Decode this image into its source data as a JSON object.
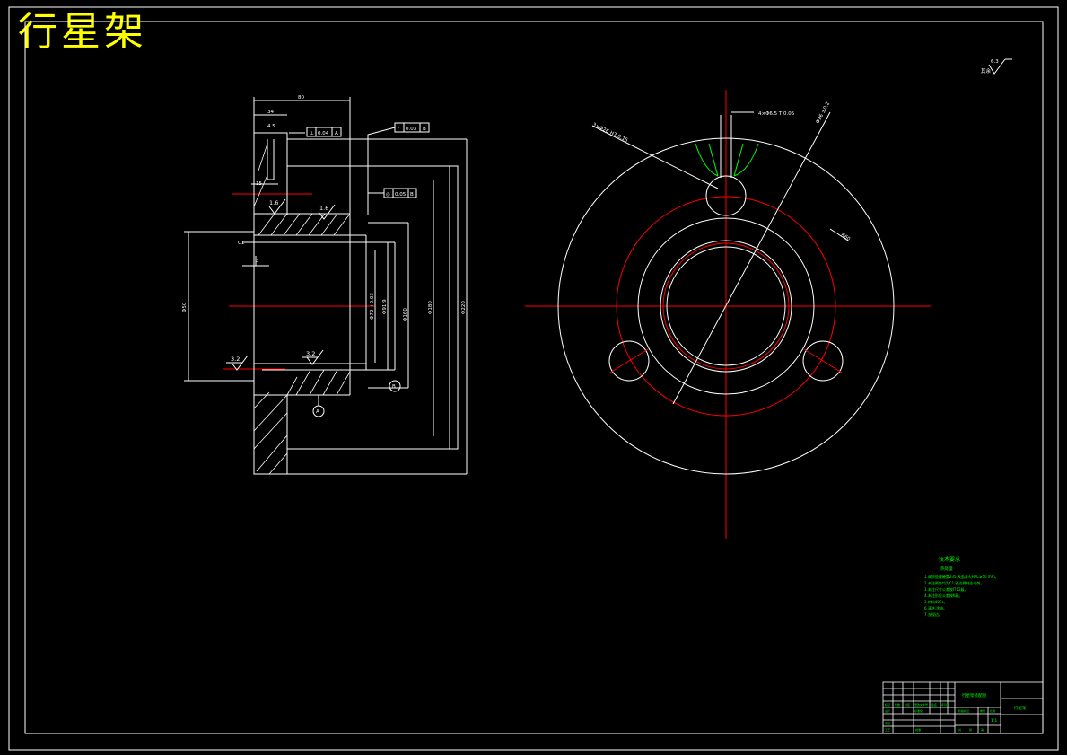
{
  "title": "行星架",
  "colors": {
    "background": "#000000",
    "lines": "#ffffff",
    "centerlines": "#ff0000",
    "text": "#ffff00",
    "notes": "#00ff00"
  },
  "section_view": {
    "dims": {
      "top_length": "80",
      "top_short": "34",
      "slot_width": "15",
      "slot_small": "4.5",
      "bore_dia": "Φ50",
      "d1": "Φ72 +0.03",
      "d2": "Φ91.9",
      "d3": "Φ160",
      "d4": "Φ180",
      "d5": "Φ220",
      "chamfer": "C1",
      "b_tol": "3"
    },
    "tolerance_frames": [
      {
        "symbol": "⊥",
        "value": "0.04",
        "datum": "A"
      },
      {
        "symbol": "/",
        "value": "0.03",
        "datum": "B"
      },
      {
        "symbol": "◎",
        "value": "0.05",
        "datum": "B"
      }
    ],
    "roughness": [
      "1.6",
      "1.6",
      "3.2",
      "3.2"
    ],
    "datums": [
      "B",
      "A"
    ]
  },
  "front_view": {
    "dims": {
      "hole_note": "3×Φ26 H7 0.15",
      "pitch_note": "4×Φ6.5 T 0.05",
      "radius_note": "Φ96 ±0.2",
      "r_note": "R60"
    }
  },
  "roughness_mark": {
    "value": "6.3",
    "prefix": "其余"
  },
  "tech_notes": {
    "heading": "技术要求",
    "sub": "热处理",
    "lines": [
      "1.调质处理硬度235,表面淬火HRC≥50 mm。",
      "2.未注倒角均为C1,锐边倒钝去毛刺。",
      "3.未注尺寸公差按IT12级。",
      "4.未注形位公差按K级。",
      "5.材料40Cr。",
      "6.清洗,涂油。",
      "7.去锐边。"
    ]
  },
  "title_block": {
    "name": "行星架装配图",
    "drawing_no": "行星架",
    "scale": "1:1",
    "labels": [
      "标记",
      "处数",
      "分区",
      "更改文件号",
      "签名",
      "年月日",
      "设计",
      "标准化",
      "审核",
      "工艺",
      "批准",
      "阶段标记",
      "重量",
      "比例",
      "共",
      "张",
      "第"
    ]
  }
}
